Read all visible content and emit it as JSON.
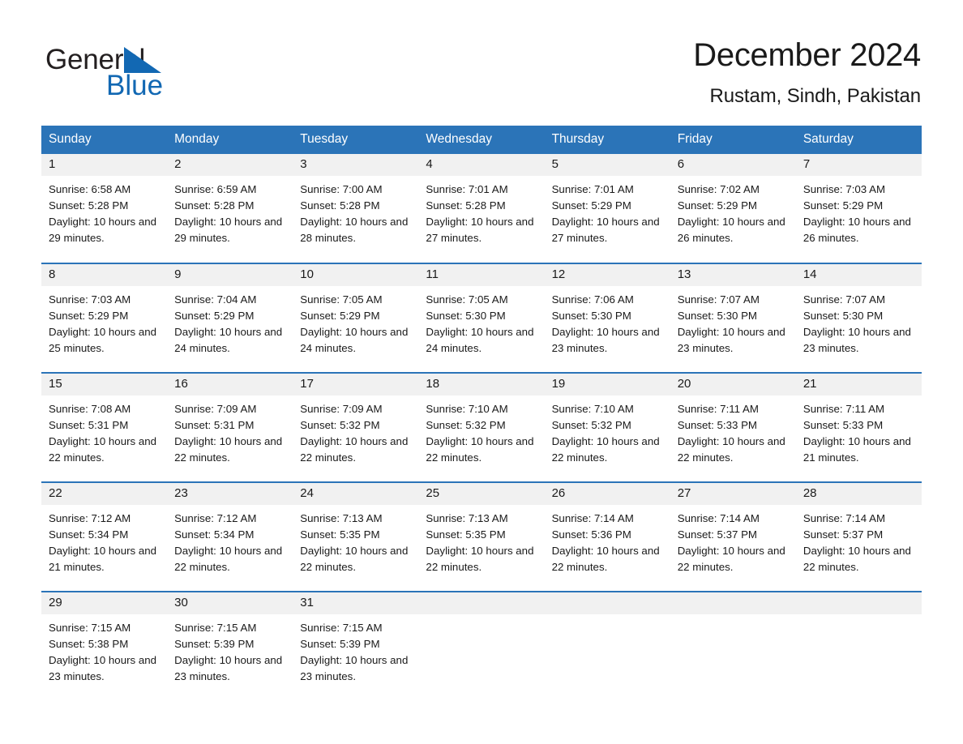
{
  "brand": {
    "name_primary": "General",
    "name_secondary": "Blue",
    "triangle_icon": "blue-triangle-icon",
    "primary_color": "#231f20",
    "secondary_color": "#1268b3"
  },
  "header": {
    "title": "December 2024",
    "subtitle": "Rustam, Sindh, Pakistan"
  },
  "theme": {
    "header_blue": "#2b74b8",
    "daynum_gray": "#f1f1f1",
    "text": "#1a1a1a"
  },
  "calendar": {
    "weekday_headers": [
      "Sunday",
      "Monday",
      "Tuesday",
      "Wednesday",
      "Thursday",
      "Friday",
      "Saturday"
    ],
    "weeks": [
      [
        {
          "day": "1",
          "info": "Sunrise: 6:58 AM\nSunset: 5:28 PM\nDaylight: 10 hours and 29 minutes."
        },
        {
          "day": "2",
          "info": "Sunrise: 6:59 AM\nSunset: 5:28 PM\nDaylight: 10 hours and 29 minutes."
        },
        {
          "day": "3",
          "info": "Sunrise: 7:00 AM\nSunset: 5:28 PM\nDaylight: 10 hours and 28 minutes."
        },
        {
          "day": "4",
          "info": "Sunrise: 7:01 AM\nSunset: 5:28 PM\nDaylight: 10 hours and 27 minutes."
        },
        {
          "day": "5",
          "info": "Sunrise: 7:01 AM\nSunset: 5:29 PM\nDaylight: 10 hours and 27 minutes."
        },
        {
          "day": "6",
          "info": "Sunrise: 7:02 AM\nSunset: 5:29 PM\nDaylight: 10 hours and 26 minutes."
        },
        {
          "day": "7",
          "info": "Sunrise: 7:03 AM\nSunset: 5:29 PM\nDaylight: 10 hours and 26 minutes."
        }
      ],
      [
        {
          "day": "8",
          "info": "Sunrise: 7:03 AM\nSunset: 5:29 PM\nDaylight: 10 hours and 25 minutes."
        },
        {
          "day": "9",
          "info": "Sunrise: 7:04 AM\nSunset: 5:29 PM\nDaylight: 10 hours and 24 minutes."
        },
        {
          "day": "10",
          "info": "Sunrise: 7:05 AM\nSunset: 5:29 PM\nDaylight: 10 hours and 24 minutes."
        },
        {
          "day": "11",
          "info": "Sunrise: 7:05 AM\nSunset: 5:30 PM\nDaylight: 10 hours and 24 minutes."
        },
        {
          "day": "12",
          "info": "Sunrise: 7:06 AM\nSunset: 5:30 PM\nDaylight: 10 hours and 23 minutes."
        },
        {
          "day": "13",
          "info": "Sunrise: 7:07 AM\nSunset: 5:30 PM\nDaylight: 10 hours and 23 minutes."
        },
        {
          "day": "14",
          "info": "Sunrise: 7:07 AM\nSunset: 5:30 PM\nDaylight: 10 hours and 23 minutes."
        }
      ],
      [
        {
          "day": "15",
          "info": "Sunrise: 7:08 AM\nSunset: 5:31 PM\nDaylight: 10 hours and 22 minutes."
        },
        {
          "day": "16",
          "info": "Sunrise: 7:09 AM\nSunset: 5:31 PM\nDaylight: 10 hours and 22 minutes."
        },
        {
          "day": "17",
          "info": "Sunrise: 7:09 AM\nSunset: 5:32 PM\nDaylight: 10 hours and 22 minutes."
        },
        {
          "day": "18",
          "info": "Sunrise: 7:10 AM\nSunset: 5:32 PM\nDaylight: 10 hours and 22 minutes."
        },
        {
          "day": "19",
          "info": "Sunrise: 7:10 AM\nSunset: 5:32 PM\nDaylight: 10 hours and 22 minutes."
        },
        {
          "day": "20",
          "info": "Sunrise: 7:11 AM\nSunset: 5:33 PM\nDaylight: 10 hours and 22 minutes."
        },
        {
          "day": "21",
          "info": "Sunrise: 7:11 AM\nSunset: 5:33 PM\nDaylight: 10 hours and 21 minutes."
        }
      ],
      [
        {
          "day": "22",
          "info": "Sunrise: 7:12 AM\nSunset: 5:34 PM\nDaylight: 10 hours and 21 minutes."
        },
        {
          "day": "23",
          "info": "Sunrise: 7:12 AM\nSunset: 5:34 PM\nDaylight: 10 hours and 22 minutes."
        },
        {
          "day": "24",
          "info": "Sunrise: 7:13 AM\nSunset: 5:35 PM\nDaylight: 10 hours and 22 minutes."
        },
        {
          "day": "25",
          "info": "Sunrise: 7:13 AM\nSunset: 5:35 PM\nDaylight: 10 hours and 22 minutes."
        },
        {
          "day": "26",
          "info": "Sunrise: 7:14 AM\nSunset: 5:36 PM\nDaylight: 10 hours and 22 minutes."
        },
        {
          "day": "27",
          "info": "Sunrise: 7:14 AM\nSunset: 5:37 PM\nDaylight: 10 hours and 22 minutes."
        },
        {
          "day": "28",
          "info": "Sunrise: 7:14 AM\nSunset: 5:37 PM\nDaylight: 10 hours and 22 minutes."
        }
      ],
      [
        {
          "day": "29",
          "info": "Sunrise: 7:15 AM\nSunset: 5:38 PM\nDaylight: 10 hours and 23 minutes."
        },
        {
          "day": "30",
          "info": "Sunrise: 7:15 AM\nSunset: 5:39 PM\nDaylight: 10 hours and 23 minutes."
        },
        {
          "day": "31",
          "info": "Sunrise: 7:15 AM\nSunset: 5:39 PM\nDaylight: 10 hours and 23 minutes."
        },
        {
          "day": "",
          "info": ""
        },
        {
          "day": "",
          "info": ""
        },
        {
          "day": "",
          "info": ""
        },
        {
          "day": "",
          "info": ""
        }
      ]
    ]
  }
}
